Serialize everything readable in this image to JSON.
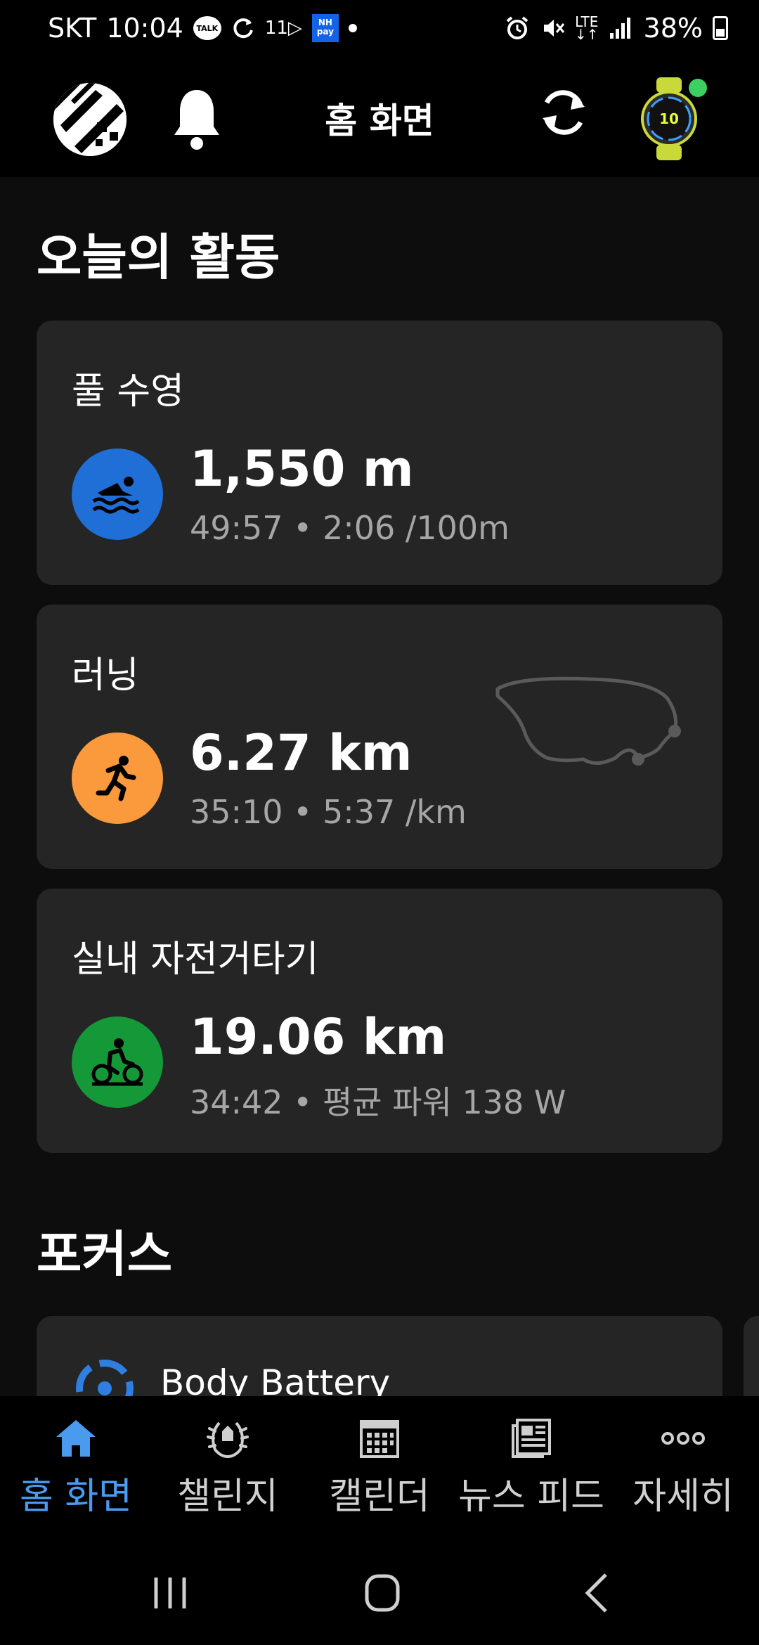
{
  "status_bar": {
    "carrier": "SKT",
    "time": "10:04",
    "talk_badge": "TALK",
    "eleven_badge": "11▷",
    "nhpay_badge_line1": "NH",
    "nhpay_badge_line2": "pay",
    "lte": "LTE",
    "battery": "38%"
  },
  "header": {
    "title": "홈 화면"
  },
  "today": {
    "section_title": "오늘의 활동",
    "activities": [
      {
        "name": "풀 수영",
        "value": "1,550 m",
        "details": "49:57 • 2:06 /100m",
        "icon": "swimmer-icon",
        "color": "#1f6fd6"
      },
      {
        "name": "러닝",
        "value": "6.27 km",
        "details": "35:10 • 5:37 /km",
        "icon": "runner-icon",
        "color": "#fb9a3c"
      },
      {
        "name": "실내 자전거타기",
        "value": "19.06 km",
        "details": "34:42 • 평균 파워 138 W",
        "icon": "cyclist-icon",
        "color": "#159838"
      }
    ]
  },
  "focus": {
    "section_title": "포커스",
    "first_card_label": "Body Battery"
  },
  "bottom_nav": [
    {
      "label": "홈 화면",
      "icon": "home-icon",
      "active": true
    },
    {
      "label": "챌린지",
      "icon": "laurel-icon",
      "active": false
    },
    {
      "label": "캘린더",
      "icon": "calendar-icon",
      "active": false
    },
    {
      "label": "뉴스 피드",
      "icon": "newsfeed-icon",
      "active": false
    },
    {
      "label": "자세히",
      "icon": "more-icon",
      "active": false
    }
  ],
  "colors": {
    "accent_blue": "#4a9bf0",
    "card_bg": "#252525",
    "page_bg": "#0d0d0d"
  }
}
